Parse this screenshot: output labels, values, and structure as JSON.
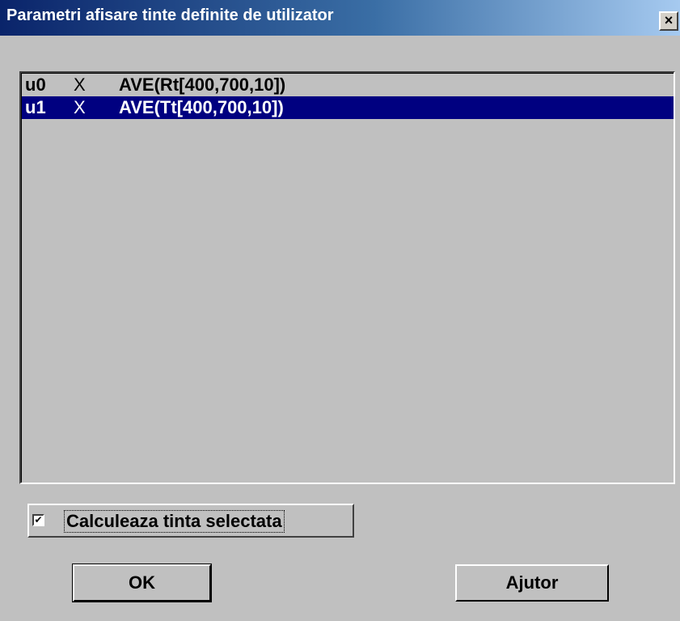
{
  "window": {
    "title": "Parametri afisare tinte definite de utilizator",
    "close_label": "×"
  },
  "list": {
    "items": [
      {
        "id": "u0",
        "flag": "X",
        "expression": "AVE(Rt[400,700,10])",
        "selected": false
      },
      {
        "id": "u1",
        "flag": "X",
        "expression": "AVE(Tt[400,700,10])",
        "selected": true
      }
    ]
  },
  "checkbox": {
    "label": "Calculeaza tinta selectata",
    "checked": true,
    "mark": "✔"
  },
  "buttons": {
    "ok_label": "OK",
    "help_label": "Ajutor"
  },
  "colors": {
    "title_start": "#0a246a",
    "title_end": "#a6caf0",
    "selection": "#000080",
    "face": "#c0c0c0"
  }
}
